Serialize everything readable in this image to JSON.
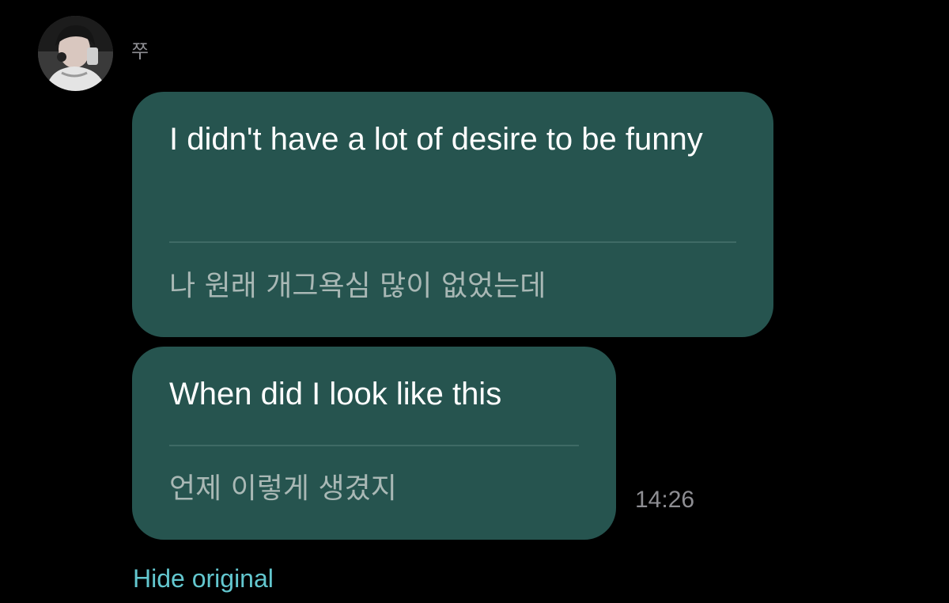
{
  "chat": {
    "sender_name": "쭈",
    "messages": [
      {
        "text": "I didn't have a lot of desire to be funny",
        "translation": "나 원래 개그욕심 많이 없었는데"
      },
      {
        "text": "When did I look like this",
        "translation": "언제 이렇게 생겼지"
      }
    ],
    "timestamp": "14:26",
    "hide_original_label": "Hide original"
  },
  "colors": {
    "background": "#000000",
    "bubble": "#26544f",
    "translation_text": "#a9b8b5",
    "meta_text": "#8e8e93",
    "link": "#63c7cf"
  },
  "icons": {
    "avatar": "user-profile-photo"
  }
}
